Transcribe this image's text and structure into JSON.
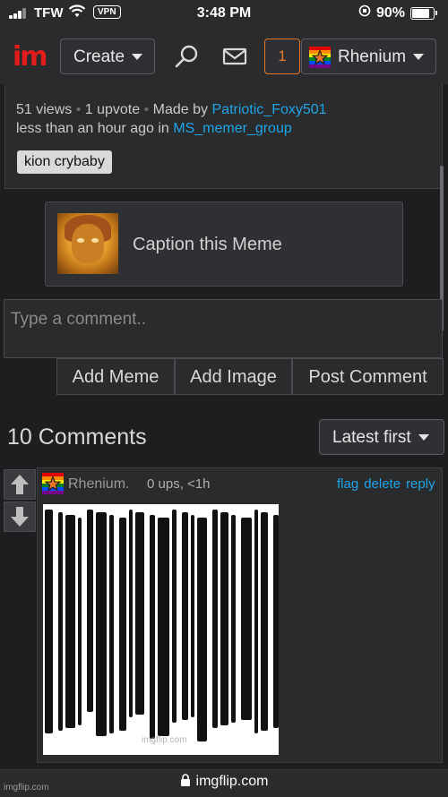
{
  "status_bar": {
    "carrier": "TFW",
    "vpn": "VPN",
    "time": "3:48 PM",
    "battery": "90%",
    "battery_level": 0.9
  },
  "nav": {
    "logo": "im",
    "create_label": "Create",
    "notification_count": "1",
    "username": "Rhenium"
  },
  "meta": {
    "views": "51 views",
    "upvotes": "1 upvote",
    "made_by_label": "Made by",
    "author": "Patriotic_Foxy501",
    "time_prefix": "less than an hour ago in",
    "stream": "MS_memer_group",
    "tag": "kion crybaby"
  },
  "caption_button": "Caption this Meme",
  "comment_input": {
    "placeholder": "Type a comment.."
  },
  "actions": {
    "add_meme": "Add Meme",
    "add_image": "Add Image",
    "post_comment": "Post Comment"
  },
  "comments_header": {
    "count": "10 Comments",
    "sort": "Latest first"
  },
  "comment": {
    "user": "Rhenium.",
    "meta": "0 ups, <1h",
    "flag": "flag",
    "delete": "delete",
    "reply": "reply",
    "image_watermark": "imgflip.com"
  },
  "browser": {
    "url": "imgflip.com",
    "watermark": "imgflip.com"
  },
  "colors": {
    "link": "#1fa5e6",
    "logo": "#e21b1b",
    "notification": "#e0772a"
  }
}
